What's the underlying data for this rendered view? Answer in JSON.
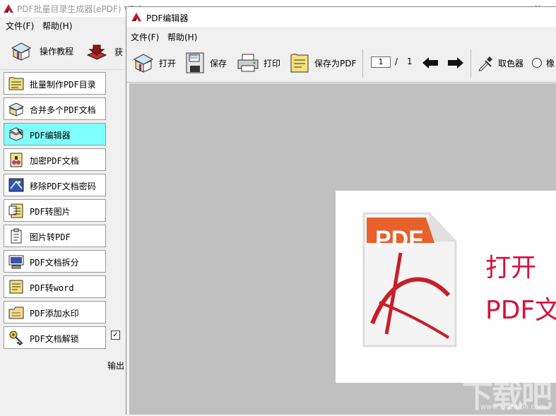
{
  "back_window": {
    "title": "PDF批量目录生成器(ePDF) V5.0",
    "menu": [
      "文件(F)",
      "帮助(H)"
    ],
    "toolbar": {
      "tutorial": "操作教程",
      "get_partial": "获"
    },
    "sidebar": [
      {
        "label": "批量制作PDF目录",
        "icon": "catalog-icon"
      },
      {
        "label": "合并多个PDF文档",
        "icon": "merge-icon"
      },
      {
        "label": "PDF编辑器",
        "icon": "editor-icon",
        "active": true
      },
      {
        "label": "加密PDF文档",
        "icon": "encrypt-icon"
      },
      {
        "label": "移除PDF文档密码",
        "icon": "remove-password-icon"
      },
      {
        "label": "PDF转图片",
        "icon": "pdf-to-image-icon"
      },
      {
        "label": "图片转PDF",
        "icon": "image-to-pdf-icon"
      },
      {
        "label": "PDF文档拆分",
        "icon": "split-icon"
      },
      {
        "label": "PDF转word",
        "icon": "pdf-to-word-icon"
      },
      {
        "label": "PDF添加水印",
        "icon": "watermark-icon"
      },
      {
        "label": "PDF文档解锁",
        "icon": "unlock-icon"
      }
    ],
    "output_partial": "输出",
    "close_glyph": "✕"
  },
  "front_window": {
    "title": "PDF编辑器",
    "menu": [
      "文件(F)",
      "帮助(H)"
    ],
    "toolbar": {
      "open": "打开",
      "save": "保存",
      "print": "打印",
      "save_as": "保存为PDF",
      "page_current": "1",
      "page_sep": "/",
      "page_total": "1",
      "color_picker": "取色器",
      "eraser_partial": "橡"
    },
    "page_preview": {
      "pdf_badge": "PDF",
      "line1": "打开",
      "line2": "PDF文"
    }
  },
  "watermark": {
    "text": "下载吧",
    "url": "www.xiazaiba.com"
  },
  "colors": {
    "accent_red": "#d4143c",
    "sidebar_active": "#80ffff",
    "canvas_gray": "#c0c0c0",
    "pdf_orange": "#e8602c"
  }
}
